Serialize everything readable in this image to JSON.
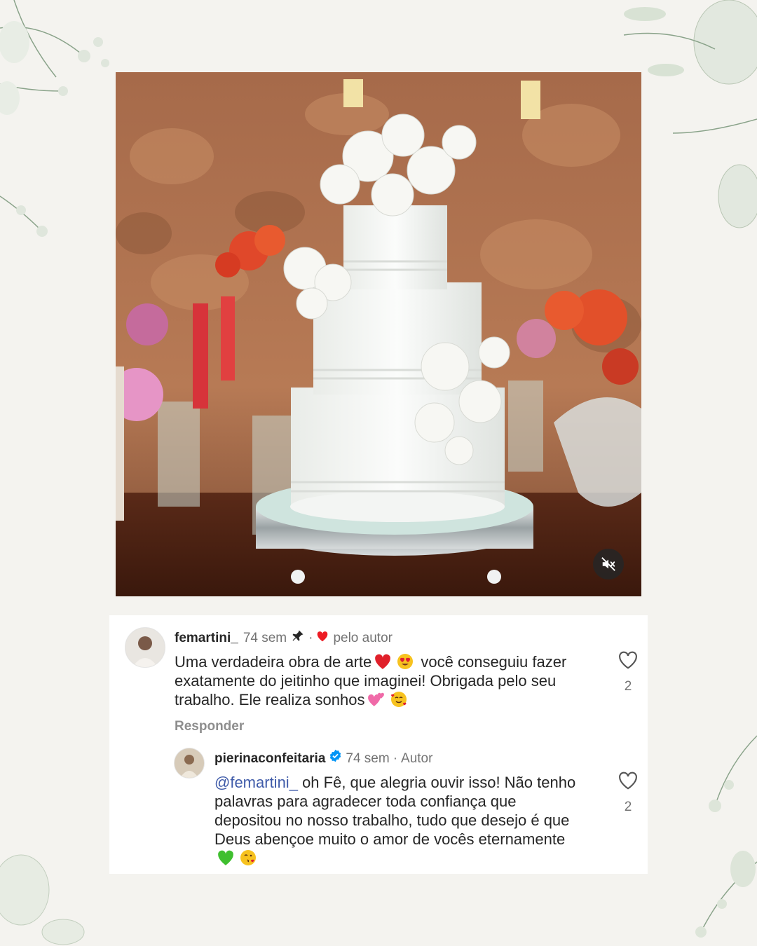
{
  "photo": {
    "alt": "",
    "mute_icon": "speaker-muted-icon"
  },
  "comments": [
    {
      "username": "femartini_",
      "time": "74 sem",
      "pinned_icon": "pin-icon",
      "liked_by_author": "pelo autor",
      "text_parts": [
        "Uma verdadeira obra de arte",
        "você conseguiu fazer exatamente do jeitinho que imaginei! Obrigada pelo seu trabalho. Ele realiza sonhos"
      ],
      "reply_label": "Responder",
      "likes": "2"
    },
    {
      "username": "pierinaconfeitaria",
      "time": "74 sem",
      "author_tag": "Autor",
      "mention": "@femartini_",
      "text": "oh Fê, que alegria ouvir isso! Não tenho palavras para agradecer toda confiança que depositou no nosso trabalho, tudo que desejo é que Deus abençoe muito o amor de vocês eternamente",
      "likes": "2"
    }
  ],
  "colors": {
    "background": "#f4f3ef",
    "mention": "#3f5ba9",
    "verified": "#0095f6",
    "heart": "#ed1c24"
  }
}
